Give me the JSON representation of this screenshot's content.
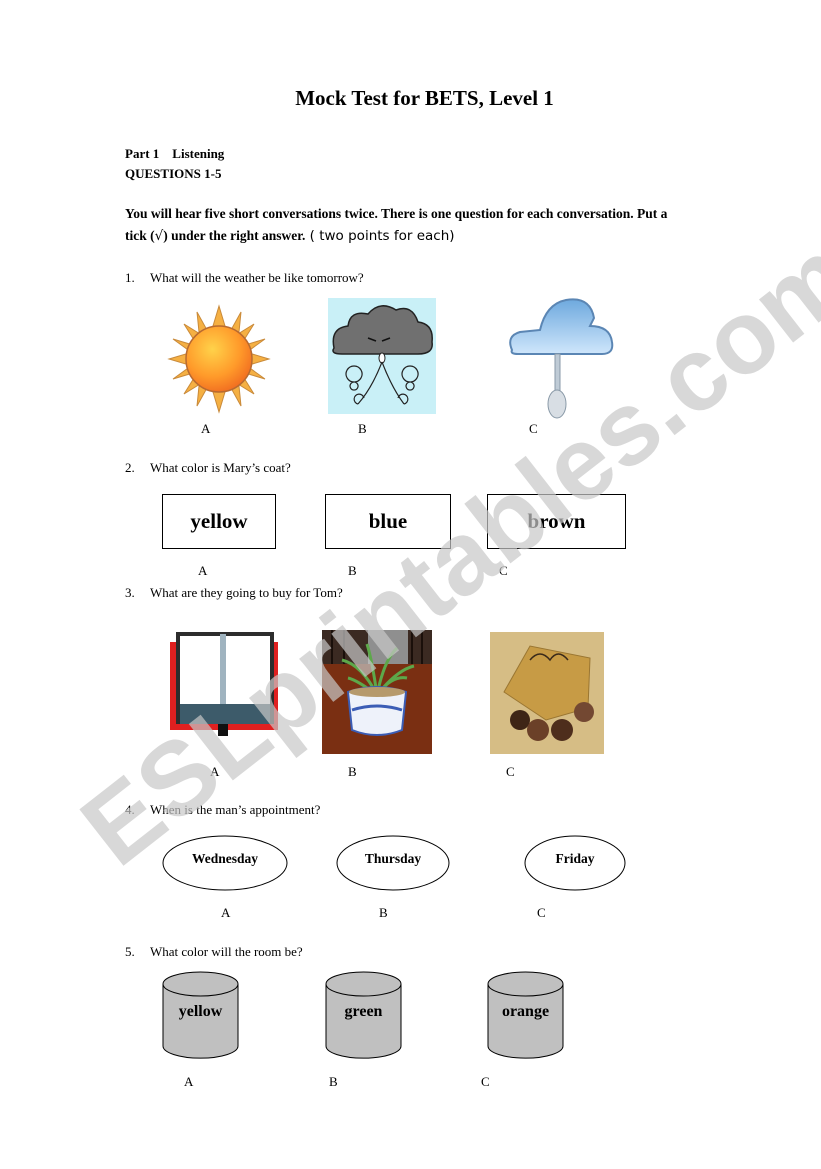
{
  "document": {
    "title": "Mock Test for BETS, Level 1",
    "part": "Part 1    Listening",
    "questions_range": "QUESTIONS 1-5",
    "instructions_line1": "You will hear five short conversations twice. There is one question for each conversation. Put a",
    "instructions_line2_a": "tick (",
    "tick_symbol": "√",
    "instructions_line2_b": ") under the right answer.",
    "instructions_points": " ( two points for each)"
  },
  "questions": [
    {
      "number": "1.",
      "text": "What will the weather be like tomorrow?",
      "options": [
        {
          "label": "A",
          "image": "sun-icon"
        },
        {
          "label": "B",
          "image": "windy-cloud-icon"
        },
        {
          "label": "C",
          "image": "rain-cloud-icon"
        }
      ]
    },
    {
      "number": "2.",
      "text": "What color is Mary’s coat?",
      "options": [
        {
          "label": "A",
          "word": "yellow"
        },
        {
          "label": "B",
          "word": "blue"
        },
        {
          "label": "C",
          "word": "brown"
        }
      ]
    },
    {
      "number": "3.",
      "text": "What are they going to buy for Tom?",
      "options": [
        {
          "label": "A",
          "image": "book-icon"
        },
        {
          "label": "B",
          "image": "potted-plant-icon"
        },
        {
          "label": "C",
          "image": "chocolate-gift-box-icon"
        }
      ]
    },
    {
      "number": "4.",
      "text": "When is the man’s appointment?",
      "options": [
        {
          "label": "A",
          "word": "Wednesday"
        },
        {
          "label": "B",
          "word": "Thursday"
        },
        {
          "label": "C",
          "word": "Friday"
        }
      ]
    },
    {
      "number": "5.",
      "text": "What color will the room be?",
      "options": [
        {
          "label": "A",
          "word": "yellow"
        },
        {
          "label": "B",
          "word": "green"
        },
        {
          "label": "C",
          "word": "orange"
        }
      ]
    }
  ],
  "watermark": {
    "text": "ESLprintables.com",
    "color": "#c8c8c8"
  }
}
